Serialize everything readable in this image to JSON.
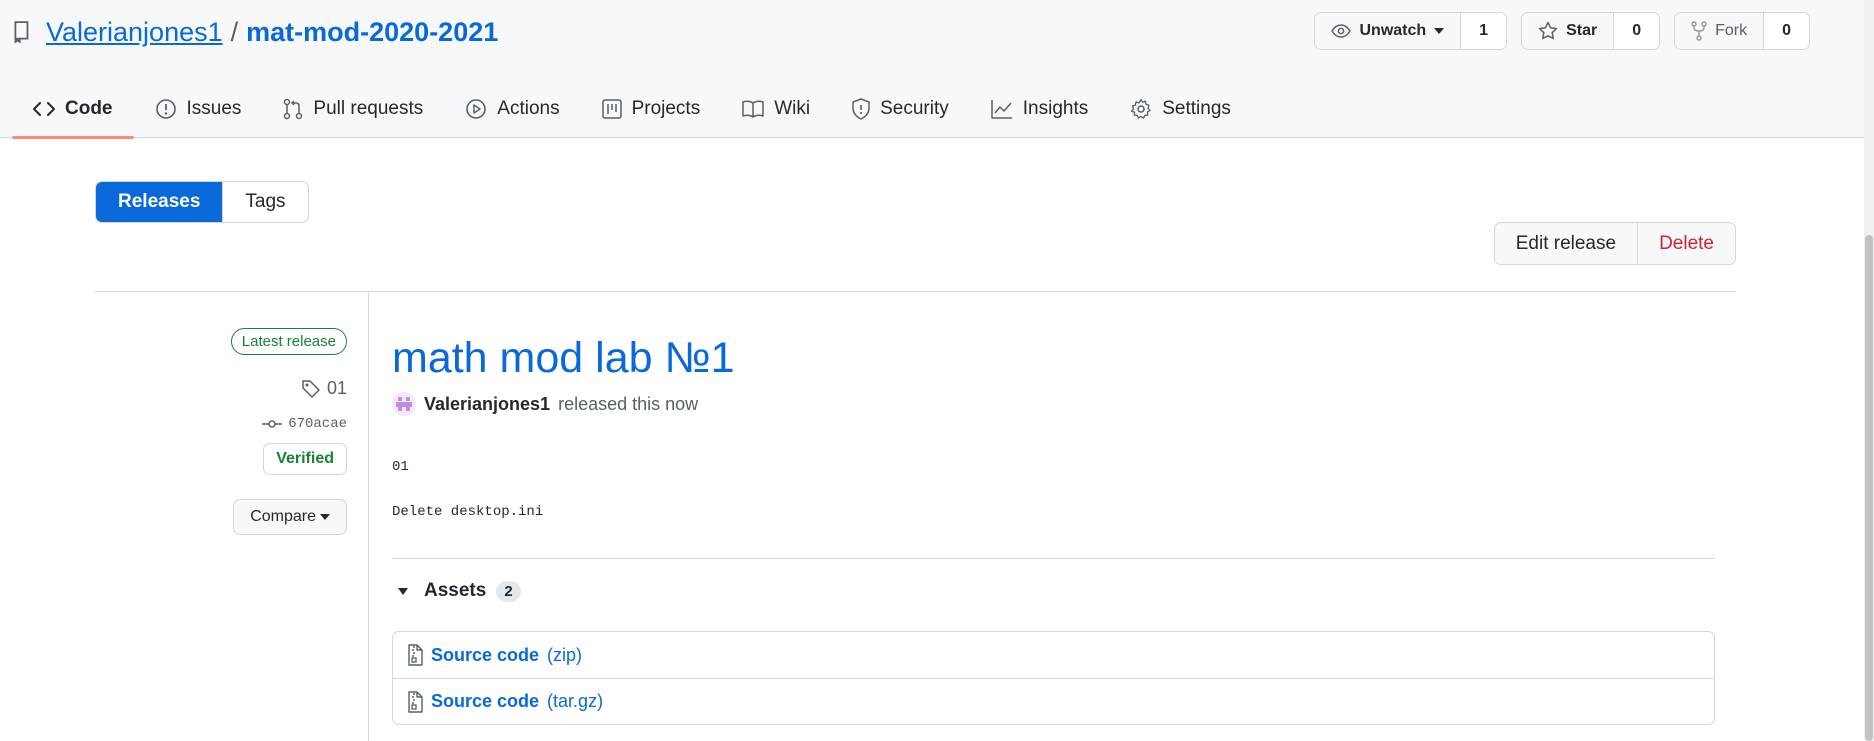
{
  "repo": {
    "owner": "Valerianjones1",
    "separator": "/",
    "name": "mat-mod-2020-2021"
  },
  "header_actions": {
    "watch": {
      "label": "Unwatch",
      "count": "1"
    },
    "star": {
      "label": "Star",
      "count": "0"
    },
    "fork": {
      "label": "Fork",
      "count": "0"
    }
  },
  "tabs": [
    {
      "label": "Code",
      "icon": "code-icon",
      "selected": true
    },
    {
      "label": "Issues",
      "icon": "issue-icon"
    },
    {
      "label": "Pull requests",
      "icon": "pull-request-icon"
    },
    {
      "label": "Actions",
      "icon": "play-icon"
    },
    {
      "label": "Projects",
      "icon": "project-icon"
    },
    {
      "label": "Wiki",
      "icon": "book-icon"
    },
    {
      "label": "Security",
      "icon": "shield-icon"
    },
    {
      "label": "Insights",
      "icon": "graph-icon"
    },
    {
      "label": "Settings",
      "icon": "gear-icon"
    }
  ],
  "subnav": {
    "releases": "Releases",
    "tags": "Tags"
  },
  "release_actions": {
    "edit": "Edit release",
    "delete": "Delete"
  },
  "release": {
    "badge": "Latest release",
    "tag": "01",
    "commit": "670acae",
    "verified": "Verified",
    "compare": "Compare",
    "title": "math mod lab №1",
    "author": "Valerianjones1",
    "released_text": "released this now",
    "notes": [
      "01",
      "Delete desktop.ini"
    ]
  },
  "assets": {
    "title": "Assets",
    "count": "2",
    "items": [
      {
        "name": "Source code",
        "format": "(zip)"
      },
      {
        "name": "Source code",
        "format": "(tar.gz)"
      }
    ]
  },
  "colors": {
    "accent": "#0969da",
    "danger": "#cf222e",
    "success": "#1a7f37",
    "tab_underline": "#fd8c73"
  }
}
